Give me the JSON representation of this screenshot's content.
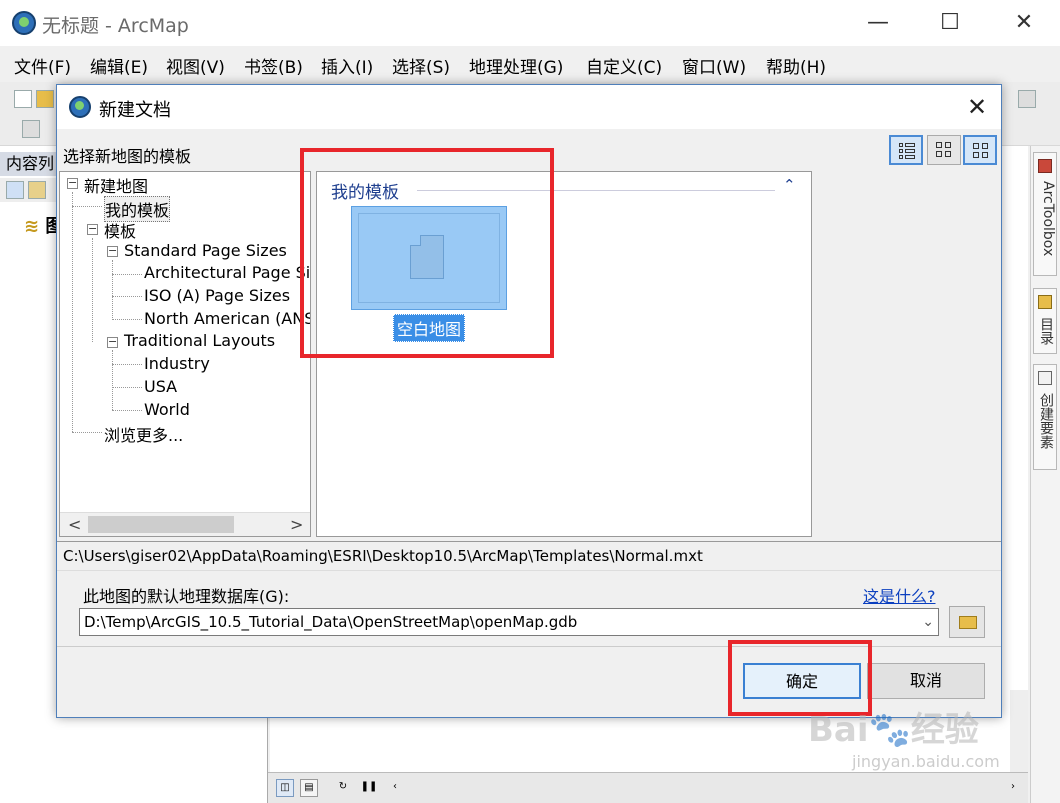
{
  "window": {
    "title": "无标题 - ArcMap",
    "minimize": "—",
    "maximize": "☐",
    "close": "✕"
  },
  "menu": [
    "文件(F)",
    "编辑(E)",
    "视图(V)",
    "书签(B)",
    "插入(I)",
    "选择(S)",
    "地理处理(G)",
    "自定义(C)",
    "窗口(W)",
    "帮助(H)"
  ],
  "toc": {
    "title": "内容列",
    "layer_glyph": "图"
  },
  "right_dock": {
    "tabs": [
      "ArcToolbox",
      "目录",
      "创建要素"
    ]
  },
  "dialog": {
    "title": "新建文档",
    "close": "✕",
    "subtitle": "选择新地图的模板",
    "tree": {
      "root": "新建地图",
      "my_templates": "我的模板",
      "templates": "模板",
      "standard_page_sizes": "Standard Page Sizes",
      "architectural": "Architectural Page Size",
      "iso": "ISO (A) Page Sizes",
      "north_american": "North American (ANSI",
      "traditional_layouts": "Traditional Layouts",
      "industry": "Industry",
      "usa": "USA",
      "world": "World",
      "browse_more": "浏览更多..."
    },
    "group_header": "我的模板",
    "tile_label": "空白地图",
    "template_path": "C:\\Users\\giser02\\AppData\\Roaming\\ESRI\\Desktop10.5\\ArcMap\\Templates\\Normal.mxt",
    "gdb_label": "此地图的默认地理数据库(G):",
    "gdb_help": "这是什么?",
    "gdb_value": "D:\\Temp\\ArcGIS_10.5_Tutorial_Data\\OpenStreetMap\\openMap.gdb",
    "ok_label": "确定",
    "cancel_label": "取消"
  },
  "watermark": {
    "text": "Bai🐾经验",
    "sub": "jingyan.baidu.com"
  },
  "colors": {
    "highlight": "#e8262b",
    "selection": "#99c9f5",
    "link": "#0b3fbf"
  }
}
